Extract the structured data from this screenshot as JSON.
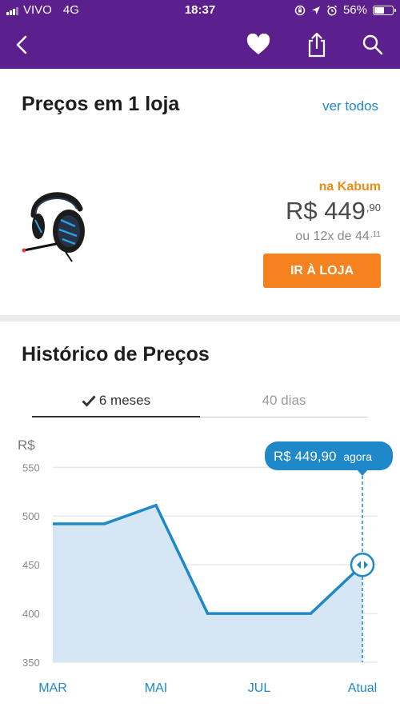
{
  "status_bar": {
    "carrier": "VIVO",
    "network": "4G",
    "time": "18:37",
    "battery": "56%",
    "battery_level": 0.56,
    "icons": [
      "signal-bars-icon",
      "rotation-lock-icon",
      "location-arrow-icon",
      "alarm-icon",
      "battery-icon"
    ]
  },
  "nav": {
    "icons": [
      "back-chevron-icon",
      "heart-icon",
      "share-icon",
      "search-icon"
    ],
    "color": "#5b1f8e"
  },
  "prices_section": {
    "title": "Preços em 1 loja",
    "see_all": "ver todos",
    "offer": {
      "store": "na Kabum",
      "price_main": "R$ 449",
      "price_cents": ",90",
      "installments_main": "ou 12x de 44",
      "installments_cents": ",11",
      "button": "IR À LOJA"
    }
  },
  "history_section": {
    "title": "Histórico de Preços",
    "tabs": [
      {
        "label": "6 meses",
        "active": true
      },
      {
        "label": "40 dias",
        "active": false
      }
    ],
    "current_price_pill": {
      "price": "R$ 449,90",
      "suffix": "agora"
    }
  },
  "colors": {
    "brand_purple": "#5b1f8e",
    "accent_blue": "#1e88c9",
    "orange": "#f5821f"
  },
  "chart_data": {
    "type": "area",
    "ylabel": "R$",
    "y_ticks": [
      350,
      400,
      450,
      500,
      550
    ],
    "ylim": [
      350,
      565
    ],
    "x_labels": [
      "MAR",
      "MAI",
      "JUL",
      "Atual"
    ],
    "x_label_positions": [
      0,
      2,
      4,
      6
    ],
    "x": [
      0,
      1,
      2,
      3,
      4,
      5,
      6
    ],
    "values": [
      492,
      492,
      511,
      400,
      400,
      400,
      449.9
    ],
    "grid": true,
    "current_marker_x": 6,
    "line_color": "#1e88c9",
    "fill_color": "#d6e6f5"
  }
}
